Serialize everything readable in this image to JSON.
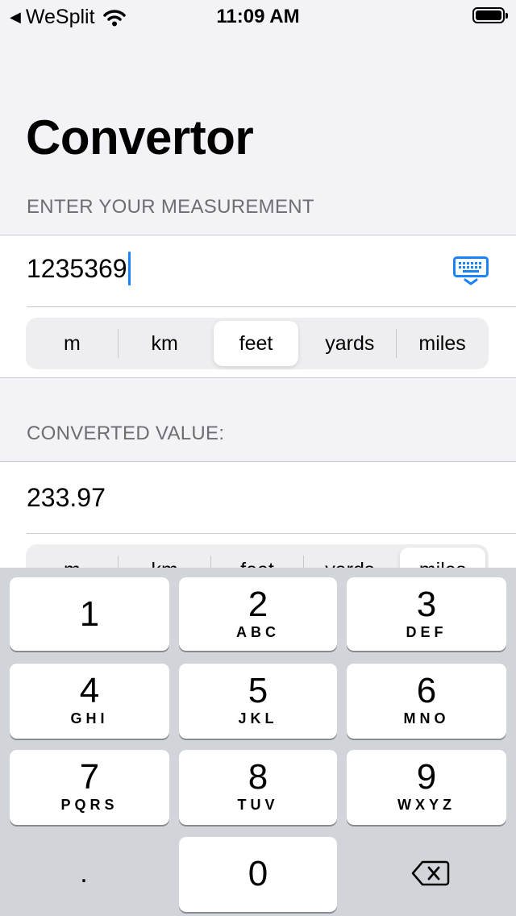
{
  "status_bar": {
    "back_label": "WeSplit",
    "time": "11:09 AM"
  },
  "nav": {
    "title": "Convertor"
  },
  "input_section": {
    "header": "ENTER YOUR MEASUREMENT",
    "value": "1235369",
    "units": [
      "m",
      "km",
      "feet",
      "yards",
      "miles"
    ],
    "selected_unit": "feet"
  },
  "output_section": {
    "header": "CONVERTED VALUE:",
    "value": "233.97",
    "units": [
      "m",
      "km",
      "feet",
      "yards",
      "miles"
    ],
    "selected_unit": "miles"
  },
  "keypad": {
    "keys": [
      {
        "num": "1",
        "letters": ""
      },
      {
        "num": "2",
        "letters": "ABC"
      },
      {
        "num": "3",
        "letters": "DEF"
      },
      {
        "num": "4",
        "letters": "GHI"
      },
      {
        "num": "5",
        "letters": "JKL"
      },
      {
        "num": "6",
        "letters": "MNO"
      },
      {
        "num": "7",
        "letters": "PQRS"
      },
      {
        "num": "8",
        "letters": "TUV"
      },
      {
        "num": "9",
        "letters": "WXYZ"
      }
    ],
    "decimal": ".",
    "zero": "0"
  },
  "colors": {
    "accent": "#1a82fb",
    "background": "#f2f2f7",
    "keyboard": "#d1d4d9"
  }
}
